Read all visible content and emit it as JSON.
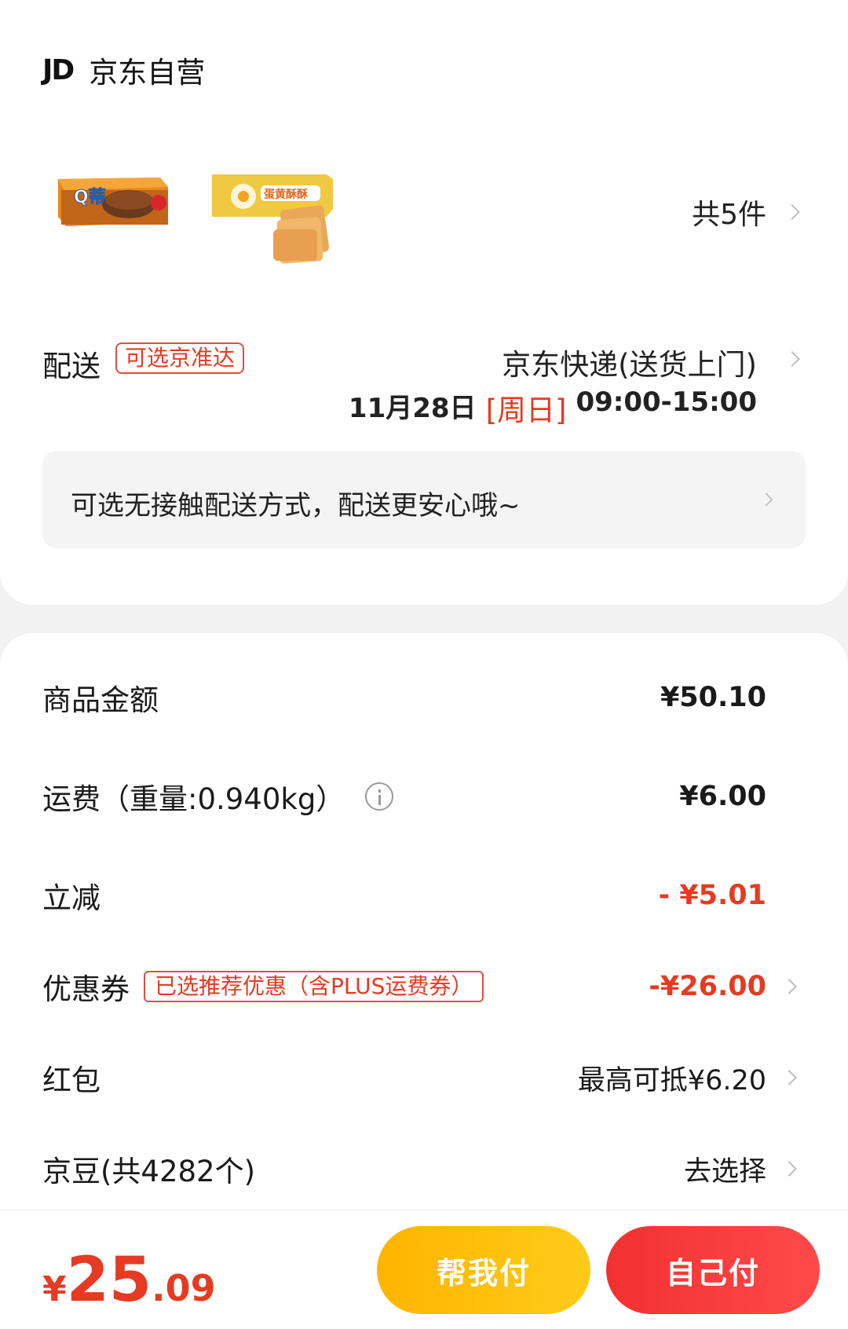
{
  "shop": {
    "logo": "JD",
    "name": "京东自营"
  },
  "products": {
    "count_label": "共5件",
    "items": [
      "Q蒂",
      "蛋黄酥酥"
    ]
  },
  "shipping": {
    "label": "配送",
    "tag": "可选京准达",
    "method": "京东快递(送货上门)",
    "date": "11月28日",
    "day": "[周日]",
    "time": "09:00-15:00",
    "notice": "可选无接触配送方式，配送更安心哦~"
  },
  "summary": {
    "goods_label": "商品金额",
    "goods_value": "¥50.10",
    "freight_label": "运费（重量:0.940kg）",
    "freight_value": "¥6.00",
    "discount_label": "立减",
    "discount_value": "- ¥5.01",
    "coupon_label": "优惠券",
    "coupon_tag": "已选推荐优惠（含PLUS运费券）",
    "coupon_value": "-¥26.00",
    "redpacket_label": "红包",
    "redpacket_value": "最高可抵¥6.20",
    "beans_label": "京豆(共4282个)",
    "beans_value": "去选择"
  },
  "footer": {
    "currency": "¥",
    "total_int": "25",
    "total_dec": ".09",
    "help_pay": "帮我付",
    "self_pay": "自己付"
  },
  "colors": {
    "accent_red": "#e63a22",
    "help_btn": "#ffbe0b",
    "self_btn": "#f23030"
  }
}
